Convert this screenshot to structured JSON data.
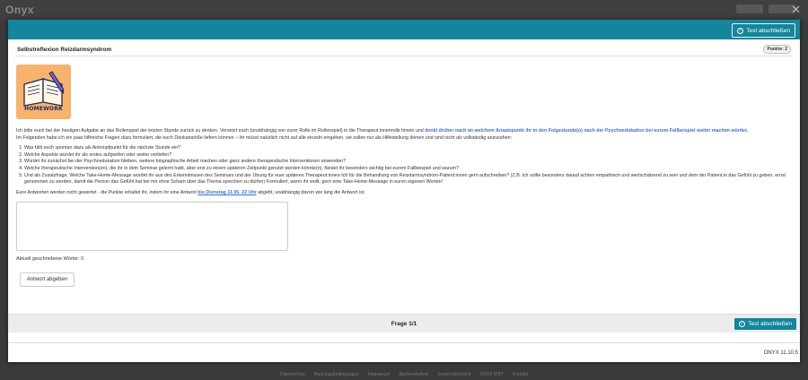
{
  "background": {
    "logo": "Onyx",
    "footer_items": [
      "Datenschutz",
      "Nutzungsbedingungen",
      "Impressum",
      "Barrierefreiheit",
      "Systemübersicht",
      "ONYX WBT",
      "Kontakt"
    ]
  },
  "modal": {
    "header_button_label": "Test abschließen",
    "question_title": "Selbstreflexion Reizdarmsyndrom",
    "points_badge": "Punkte: 2",
    "image_caption": "HOMEWORK",
    "intro_part1": "Ich bitte euch bei der heutigen Aufgabe an das Rollenspiel der letzten Stunde zurück zu denken. Versetzt euch (unabhängig von eurer Rolle im Rollenspiel) in die Therapeut innenrolle hinein und ",
    "intro_highlight": "denkt drüber nach an welchem Ansatzpunkt ihr in den Folgestunde(n) nach der Psychoedukation bei eurem Fallbeispiel weiter machen würdet.",
    "intro_line2": "Im Folgenden habe ich ein paar hilfreiche Fragen dazu formuliert, die euch Denkanstöße liefern können – ihr müsst natürlich nicht auf alle einzeln eingehen, sie sollen nur als Hilfestellung dienen und sind nicht als vollständig anzusehen:",
    "questions": [
      "Was fällt euch spontan dazu als Anknüpfpunkt für die nächste Stunde ein?",
      "Welche Aspekte würdet ihr als erstes aufgreifen oder weiter vertiefen?",
      "Würdet ihr zunächst bei der Psychoedukation bleiben, weitere biographische Arbeit machen oder ganz andere therapeutische Interventionen anwenden?",
      "Welche therapeutische Intervention(en), die ihr in dem Seminar gelernt habt, aber erst zu einem späteren Zeitpunkt genutzt werden könnte(n), fändet ihr besonders wichtig bei eurem Fallbeispiel und warum?",
      "Und als Zusatzfrage: Welche Take-Home-Message würdet ihr aus den Erkenntnissen des Seminars und der Übung für euer späteres Therapeut:innen-Ich für die Behandlung von Reizdarmsyndrom-Patient:innen gern aufschreiben? (Z.B. ich sollte besonders darauf achten empathisch und wertschätzend zu sein und dem der Patient:in das Gefühl zu geben, ernst genommen zu werden, damit die Person das Gefühl hat bei mir ohne Scham über das Thema sprechen zu dürfen) Formuliert, wenn ihr wollt, gern eine Take-Home-Message in euren eigenen Worten!"
    ],
    "grading_part1": "Eure Antworten werden nicht gewertet - die Punkte erhaltet ihr, indem ihr eine Antwort ",
    "grading_deadline": "bis Dienstag 11.05. 22 Uhr",
    "grading_part2": " abgebt, unabhängig davon wie lang die Antwort ist.",
    "answer_value": "",
    "word_count_label": "Aktuell geschriebene Wörter: 0",
    "submit_label": "Antwort abgeben",
    "pagination": "Frage 1/1",
    "footer_version": "ONYX 11.10.5"
  },
  "colors": {
    "accent": "#13859c",
    "link": "#3b6fcf",
    "image_bg": "#f7b26c"
  }
}
